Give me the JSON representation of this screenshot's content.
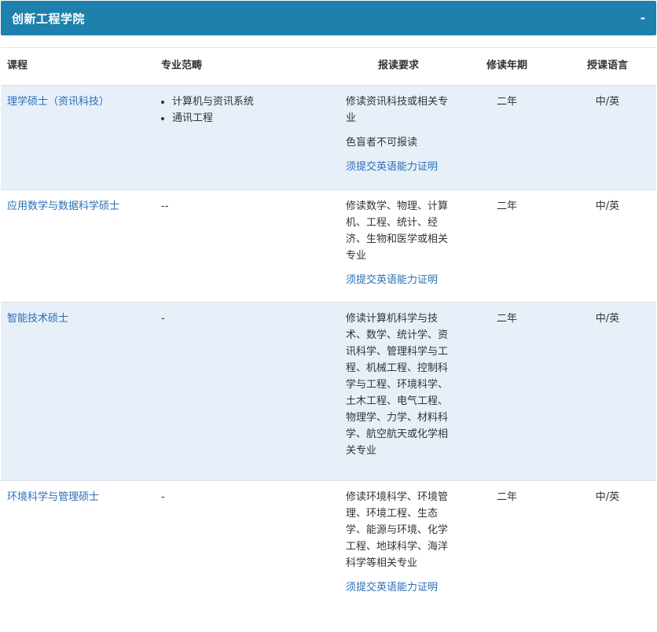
{
  "section": {
    "title": "创新工程学院",
    "collapse_label": "-"
  },
  "columns": {
    "program": "课程",
    "scope": "专业范畴",
    "requirements": "报读要求",
    "duration": "修读年期",
    "language": "授课语言"
  },
  "rows": [
    {
      "program": "理学硕士（资讯科技）",
      "scope": [
        "计算机与资讯系统",
        "通讯工程"
      ],
      "req_text": "修读资讯科技或相关专业",
      "req_note": "色盲者不可报读",
      "req_link": "须提交英语能力证明",
      "duration": "二年",
      "language": "中/英"
    },
    {
      "program": "应用数学与数据科学硕士",
      "scope_text": "--",
      "req_text": "修读数学、物理、计算机、工程、统计、经济、生物和医学或相关专业",
      "req_link": "须提交英语能力证明",
      "duration": "二年",
      "language": "中/英"
    },
    {
      "program": "智能技术硕士",
      "scope_text": "-",
      "req_text": "修读计算机科学与技术、数学、统计学、资讯科学、管理科学与工程、机械工程、控制科学与工程、环境科学、土木工程、电气工程、物理学、力学、材料科学、航空航天或化学相关专业",
      "duration": "二年",
      "language": "中/英"
    },
    {
      "program": "环境科学与管理硕士",
      "scope_text": "-",
      "req_text": "修读环境科学、环境管理、环境工程、生态学、能源与环境、化学工程、地球科学、海洋科学等相关专业",
      "req_link": "须提交英语能力证明",
      "duration": "二年",
      "language": "中/英"
    }
  ]
}
